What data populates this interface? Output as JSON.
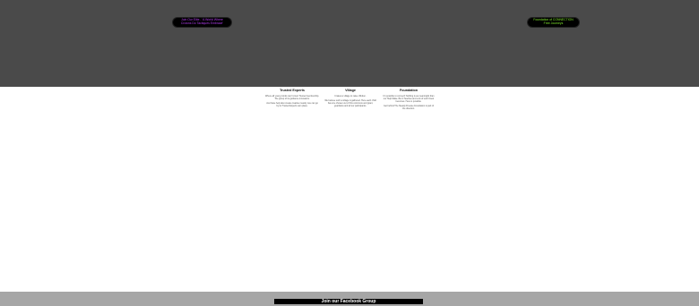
{
  "hero": {
    "left_badge": {
      "line1": "Join Our Elite - 'A World Where",
      "line2": "Crowns Do Tactiques Embrace'"
    },
    "right_badge": {
      "line1": "Foundation of CONNECTION",
      "line2": "Free Journeys"
    }
  },
  "features": [
    {
      "title": "Trusted Experts",
      "paragraphs": [
        "Where all young minds can hi-trest Trusted membership. The group of its guidance innovators.",
        "Just have help also create creative meanly one can go by its Trusted Experts own place."
      ]
    },
    {
      "title": "Village",
      "paragraphs": [
        "It takes a village to raise children.",
        "We believe such a village is gathered. Here each child has one chosen out of this commons and grant, guardians and all our participants."
      ]
    },
    {
      "title": "Foundation",
      "paragraphs": [
        "It's possible to connect! Nothing is as meaningful than our Help Make. But it Teaches and a lot of such finest becomes. Here is possible.",
        "Get behind The Steady Finesse Foundation is part of the direction."
      ]
    }
  ],
  "footer": {
    "facebook_button": "Join our Facebook Group"
  },
  "colors": {
    "hero_bg": "#4a4a4a",
    "footer_bg": "#a6a6a6",
    "left_badge_text": "#b23cf0",
    "right_badge_text": "#7ee62a"
  }
}
